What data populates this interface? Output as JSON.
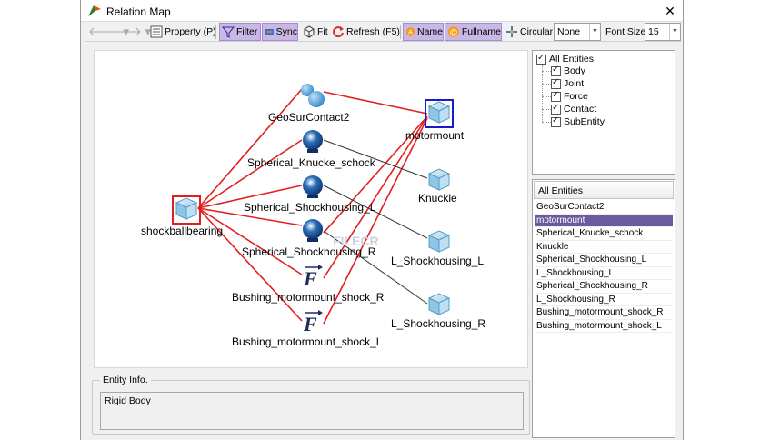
{
  "window": {
    "title": "Relation Map",
    "close_glyph": "✕"
  },
  "toolbar": {
    "property_label": "Property (P)",
    "filter_label": "Filter",
    "sync_label": "Sync",
    "fit_label": "Fit",
    "refresh_label": "Refresh (F5)",
    "name_label": "Name",
    "fullname_label": "Fullname",
    "circular_label": "Circular",
    "layout_select_value": "None",
    "font_size_label": "Font Size",
    "font_size_value": "15"
  },
  "map": {
    "nodes": {
      "geosurcontact": "GeoSurContact2",
      "motormount": "motormount",
      "spherical_knucke": "Spherical_Knucke_schock",
      "knuckle": "Knuckle",
      "spherical_shock_l": "Spherical_Shockhousing_L",
      "shockballbearing": "shockballbearing",
      "spherical_shock_r": "Spherical_Shockhousing_R",
      "l_shock_1": "L_Shockhousing_L",
      "bushing_r": "Bushing_motormount_shock_R",
      "l_shock_2": "L_Shockhousing_R",
      "bushing_l": "Bushing_motormount_shock_L"
    },
    "watermark": "FILECR"
  },
  "entity_info": {
    "legend": "Entity Info.",
    "value": "Rigid Body"
  },
  "tree": {
    "root": "All Entities",
    "children": [
      "Body",
      "Joint",
      "Force",
      "Contact",
      "SubEntity"
    ]
  },
  "list": {
    "header": "All Entities",
    "items": [
      "GeoSurContact2",
      "motormount",
      "Spherical_Knucke_schock",
      "Knuckle",
      "Spherical_Shockhousing_L",
      "L_Shockhousing_L",
      "Spherical_Shockhousing_R",
      "L_Shockhousing_R",
      "Bushing_motormount_shock_R",
      "Bushing_motormount_shock_L"
    ],
    "selected_index": 1
  },
  "colors": {
    "accent": "#6a5a9e",
    "edge_red": "#e02020",
    "edge_black": "#333333",
    "select_blue": "#1a1acc"
  },
  "icons": [
    "app-logo-icon",
    "back-arrow-icon",
    "forward-arrow-icon",
    "property-icon",
    "filter-icon",
    "sync-icon",
    "fit-icon",
    "refresh-icon",
    "name-icon",
    "fullname-icon",
    "circular-icon",
    "body-cube-icon",
    "contact-sphere-icon",
    "spherical-joint-icon",
    "force-icon"
  ]
}
